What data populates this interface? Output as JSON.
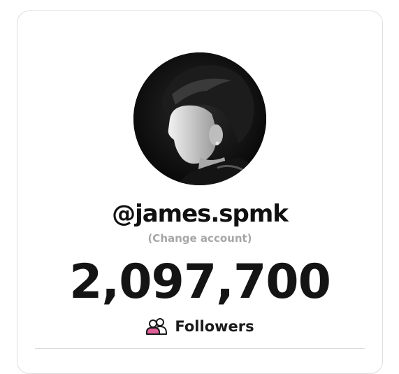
{
  "profile": {
    "username": "@james.spmk",
    "change_account": "(Change account)",
    "follower_count": "2,097,700",
    "followers_label": "Followers",
    "avatar_icon": "profile-photo",
    "followers_icon": "users-icon",
    "accent_color": "#e0609a"
  }
}
